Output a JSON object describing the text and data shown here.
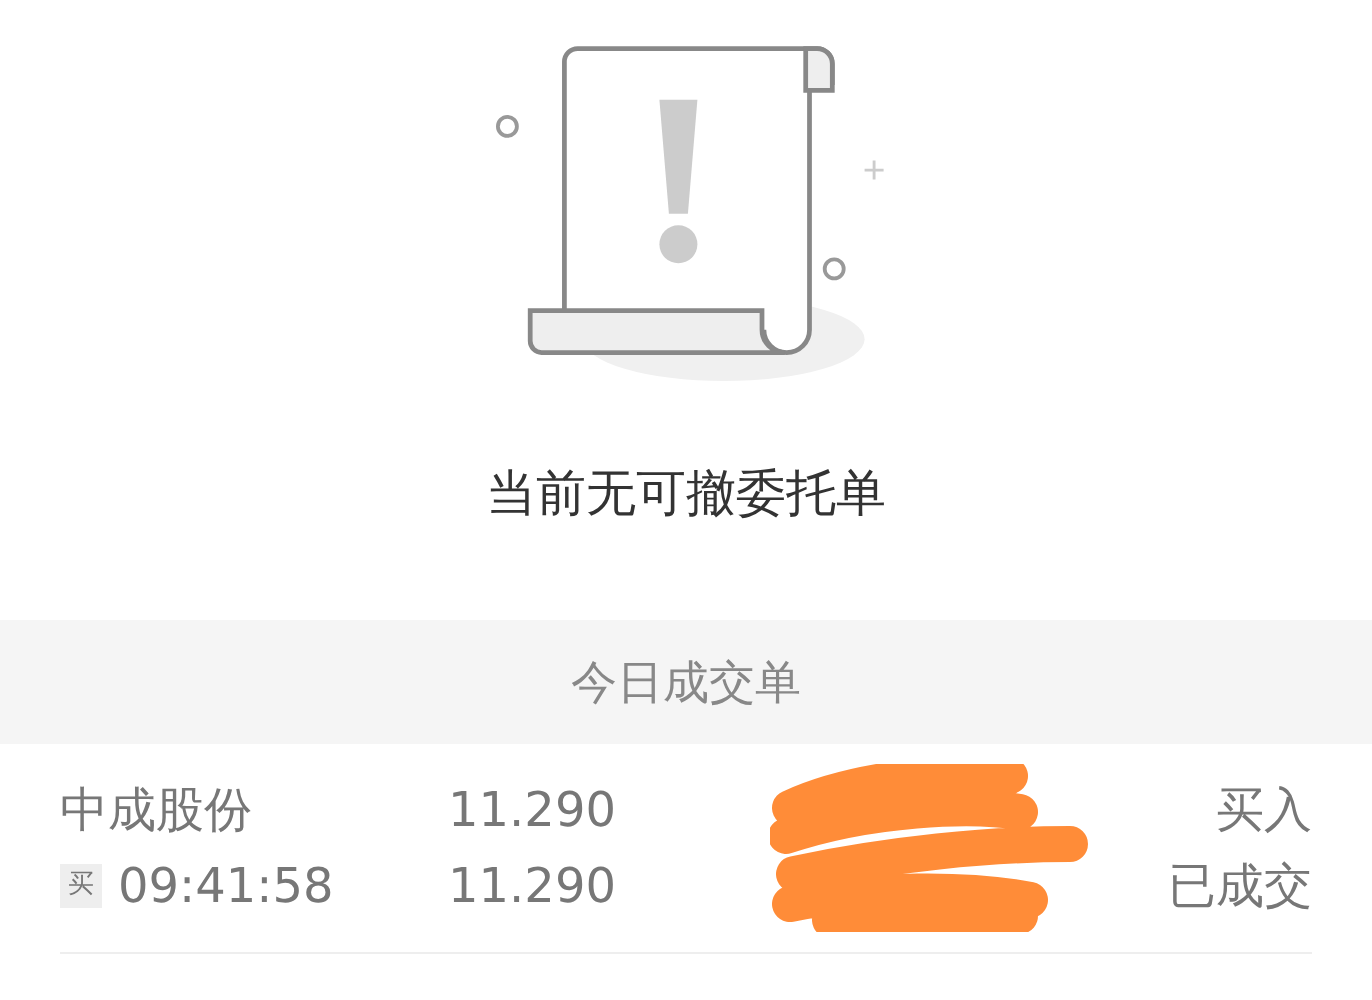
{
  "empty_state": {
    "message": "当前无可撤委托单"
  },
  "section": {
    "title": "今日成交单"
  },
  "trades": [
    {
      "name": "中成股份",
      "side_tag": "买",
      "time": "09:41:58",
      "price_1": "11.290",
      "price_2": "11.290",
      "side": "买入",
      "status": "已成交"
    }
  ]
}
